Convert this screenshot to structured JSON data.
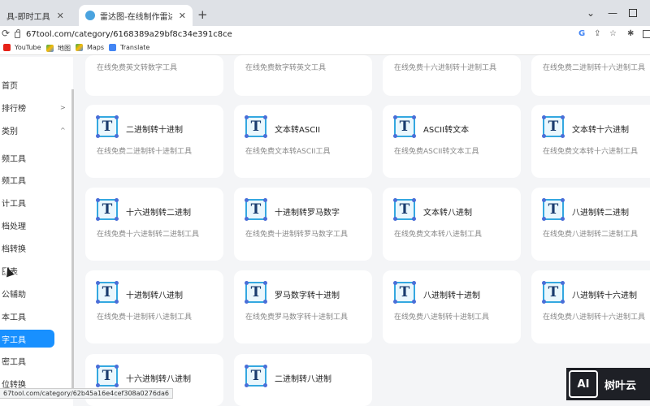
{
  "browser": {
    "tabs": [
      {
        "title": "具-即时工具",
        "favicon_color": "#e8453c"
      },
      {
        "title": "雷达图-在线制作雷达图、傲视…",
        "favicon_color": "#4aa3df"
      }
    ],
    "new_tab": "+",
    "address": "67tool.com/category/6168389a29bf8c34e391c8ce",
    "bookmarks": [
      {
        "label": "YouTube",
        "icon": "youtube-icon"
      },
      {
        "label": "地图",
        "icon": "maps-icon"
      },
      {
        "label": "Maps",
        "icon": "maps-icon"
      },
      {
        "label": "Translate",
        "icon": "translate-icon"
      }
    ],
    "status_url": "67tool.com/category/62b45a16e4cef308a0276da6"
  },
  "sidebar": {
    "items": [
      {
        "label": "首页"
      },
      {
        "label": "排行榜",
        "chevron": ">"
      },
      {
        "label": "类别",
        "chevron": "^"
      },
      {
        "label": "频工具"
      },
      {
        "label": "频工具"
      },
      {
        "label": "计工具"
      },
      {
        "label": "档处理"
      },
      {
        "label": "档转换"
      },
      {
        "label": "图表"
      },
      {
        "label": "公辅助"
      },
      {
        "label": "本工具"
      },
      {
        "label": "字工具"
      },
      {
        "label": "密工具"
      },
      {
        "label": "位转换"
      }
    ],
    "active_index": 11
  },
  "top_row": [
    {
      "desc": "在线免费英文转数字工具"
    },
    {
      "desc": "在线免费数字转英文工具"
    },
    {
      "desc": "在线免费十六进制转十进制工具"
    },
    {
      "desc": "在线免费二进制转十六进制工具"
    }
  ],
  "cards": [
    {
      "title": "二进制转十进制",
      "desc": "在线免费二进制转十进制工具"
    },
    {
      "title": "文本转ASCII",
      "desc": "在线免费文本转ASCII工具"
    },
    {
      "title": "ASCII转文本",
      "desc": "在线免费ASCII转文本工具"
    },
    {
      "title": "文本转十六进制",
      "desc": "在线免费文本转十六进制工具"
    },
    {
      "title": "十六进制转二进制",
      "desc": "在线免费十六进制转二进制工具"
    },
    {
      "title": "十进制转罗马数字",
      "desc": "在线免费十进制转罗马数字工具"
    },
    {
      "title": "文本转八进制",
      "desc": "在线免费文本转八进制工具"
    },
    {
      "title": "八进制转二进制",
      "desc": "在线免费八进制转二进制工具"
    },
    {
      "title": "十进制转八进制",
      "desc": "在线免费十进制转八进制工具"
    },
    {
      "title": "罗马数字转十进制",
      "desc": "在线免费罗马数字转十进制工具"
    },
    {
      "title": "八进制转十进制",
      "desc": "在线免费八进制转十进制工具"
    },
    {
      "title": "八进制转十六进制",
      "desc": "在线免费八进制转十六进制工具"
    },
    {
      "title": "十六进制转八进制",
      "desc": ""
    },
    {
      "title": "二进制转八进制",
      "desc": ""
    }
  ],
  "card_icon_letter": "T",
  "watermark": {
    "logo": "AI",
    "text": "树叶云"
  },
  "colors": {
    "accent": "#1890ff",
    "icon_border": "#34a8e0",
    "icon_dot": "#4a6ed8"
  }
}
